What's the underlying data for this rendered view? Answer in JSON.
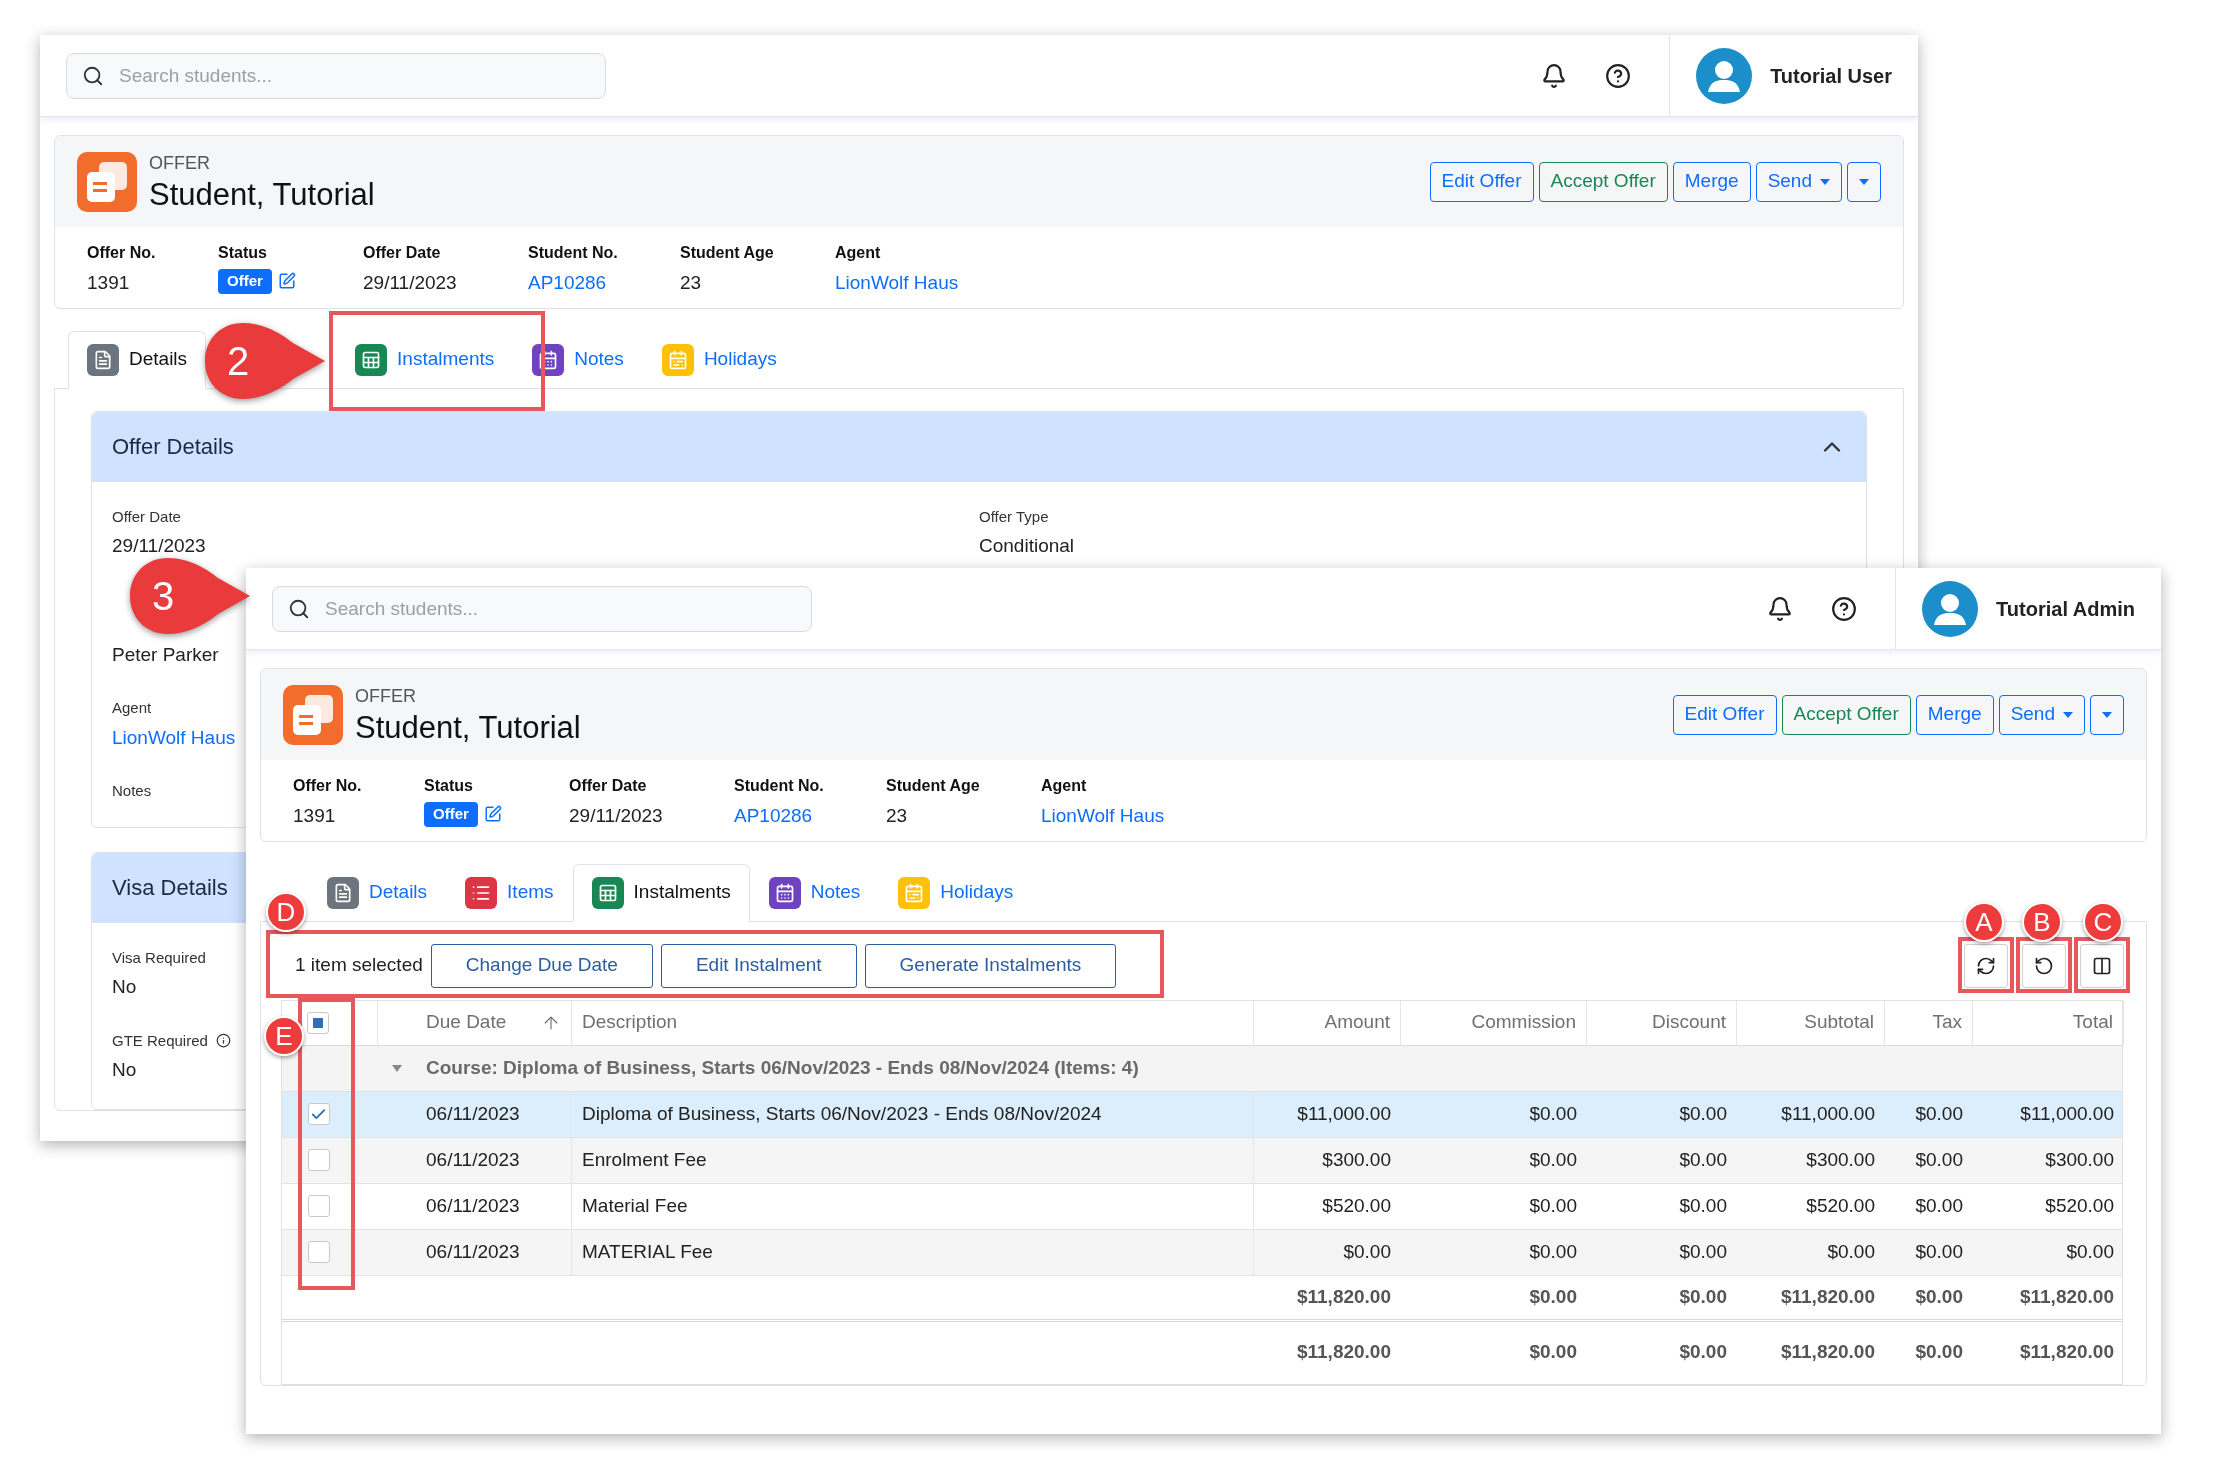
{
  "windows": [
    {
      "kind": "details",
      "search": {
        "placeholder": "Search students..."
      },
      "user": {
        "name": "Tutorial User"
      },
      "offer": {
        "type_label": "OFFER",
        "name": "Student, Tutorial",
        "buttons": [
          {
            "label": "Edit Offer",
            "kind": "primary"
          },
          {
            "label": "Accept Offer",
            "kind": "success"
          },
          {
            "label": "Merge",
            "kind": "primary"
          },
          {
            "label": "Send",
            "kind": "dropdown"
          },
          {
            "kind": "caret"
          }
        ],
        "fields": [
          {
            "label": "Offer No.",
            "value": "1391",
            "kind": "text"
          },
          {
            "label": "Status",
            "value": "Offer",
            "kind": "badge"
          },
          {
            "label": "Offer Date",
            "value": "29/11/2023",
            "kind": "text"
          },
          {
            "label": "Student No.",
            "value": "AP10286",
            "kind": "link"
          },
          {
            "label": "Student Age",
            "value": "23",
            "kind": "text"
          },
          {
            "label": "Agent",
            "value": "LionWolf Haus",
            "kind": "link"
          }
        ]
      },
      "tabs": [
        {
          "label": "Details",
          "kind": "details",
          "color": "#6c757d",
          "selected": true
        },
        {
          "label": "Instalments",
          "kind": "instalments",
          "color": "#198754",
          "selected": false
        },
        {
          "label": "Notes",
          "kind": "notes",
          "color": "#6f42c1",
          "selected": false
        },
        {
          "label": "Holidays",
          "kind": "holidays",
          "color": "#ffc107",
          "selected": false
        }
      ],
      "sections": [
        {
          "title": "Offer Details",
          "expanded": true,
          "fields": [
            {
              "label": "Offer Date",
              "value": "29/11/2023",
              "kind": "text"
            },
            {
              "value": "Peter Parker",
              "kind": "text"
            },
            {
              "label": "Agent",
              "value": "LionWolf Haus",
              "kind": "link"
            },
            {
              "label": "Notes",
              "kind": "text"
            }
          ],
          "side_fields": [
            {
              "label": "Offer Type",
              "value": "Conditional",
              "kind": "text"
            }
          ]
        },
        {
          "title": "Visa Details",
          "fields": [
            {
              "label": "Visa Required",
              "value": "No",
              "kind": "text"
            },
            {
              "label": "GTE Required",
              "value": "No",
              "kind": "info"
            }
          ]
        }
      ]
    },
    {
      "kind": "instalments",
      "search": {
        "placeholder": "Search students..."
      },
      "user": {
        "name": "Tutorial Admin"
      },
      "offer": {
        "type_label": "OFFER",
        "name": "Student, Tutorial",
        "buttons": [
          {
            "label": "Edit Offer",
            "kind": "primary"
          },
          {
            "label": "Accept Offer",
            "kind": "success"
          },
          {
            "label": "Merge",
            "kind": "primary"
          },
          {
            "label": "Send",
            "kind": "dropdown"
          },
          {
            "kind": "caret"
          }
        ],
        "fields": [
          {
            "label": "Offer No.",
            "value": "1391",
            "kind": "text"
          },
          {
            "label": "Status",
            "value": "Offer",
            "kind": "badge"
          },
          {
            "label": "Offer Date",
            "value": "29/11/2023",
            "kind": "text"
          },
          {
            "label": "Student No.",
            "value": "AP10286",
            "kind": "link"
          },
          {
            "label": "Student Age",
            "value": "23",
            "kind": "text"
          },
          {
            "label": "Agent",
            "value": "LionWolf Haus",
            "kind": "link"
          }
        ]
      },
      "tabs": [
        {
          "label": "Details",
          "kind": "details",
          "color": "#6c757d",
          "selected": false
        },
        {
          "label": "Items",
          "kind": "items",
          "color": "#dc3545",
          "selected": false
        },
        {
          "label": "Instalments",
          "kind": "instalments",
          "color": "#198754",
          "selected": true
        },
        {
          "label": "Notes",
          "kind": "notes",
          "color": "#6f42c1",
          "selected": false
        },
        {
          "label": "Holidays",
          "kind": "holidays",
          "color": "#ffc107",
          "selected": false
        }
      ],
      "instalments": {
        "selection_text": "1 item selected",
        "actions": [
          "Change Due Date",
          "Edit Instalment",
          "Generate Instalments"
        ],
        "tools": [
          {
            "kind": "refresh"
          },
          {
            "kind": "reset"
          },
          {
            "kind": "columns"
          }
        ],
        "table": {
          "select_all": {
            "indeterminate": true
          },
          "columns": [
            {
              "label": "Due Date",
              "kind": "text",
              "sorted": true
            },
            {
              "label": "Description",
              "kind": "text",
              "sorted": false
            },
            {
              "label": "Amount",
              "kind": "money",
              "sorted": false
            },
            {
              "label": "Commission",
              "kind": "money",
              "sorted": false
            },
            {
              "label": "Discount",
              "kind": "money",
              "sorted": false
            },
            {
              "label": "Subtotal",
              "kind": "money",
              "sorted": false
            },
            {
              "label": "Tax",
              "kind": "money",
              "sorted": false
            },
            {
              "label": "Total",
              "kind": "money",
              "sorted": false
            }
          ],
          "groups": [
            {
              "title": "Course: Diploma of Business, Starts 06/Nov/2023 - Ends 08/Nov/2024 (Items: 4)",
              "expanded": true,
              "rows": [
                {
                  "selected": true,
                  "cells": [
                    "06/11/2023",
                    "Diploma of Business, Starts 06/Nov/2023 - Ends 08/Nov/2024",
                    "$11,000.00",
                    "$0.00",
                    "$0.00",
                    "$11,000.00",
                    "$0.00",
                    "$11,000.00"
                  ]
                },
                {
                  "selected": false,
                  "cells": [
                    "06/11/2023",
                    "Enrolment Fee",
                    "$300.00",
                    "$0.00",
                    "$0.00",
                    "$300.00",
                    "$0.00",
                    "$300.00"
                  ]
                },
                {
                  "selected": false,
                  "cells": [
                    "06/11/2023",
                    "Material Fee",
                    "$520.00",
                    "$0.00",
                    "$0.00",
                    "$520.00",
                    "$0.00",
                    "$520.00"
                  ]
                },
                {
                  "selected": false,
                  "cells": [
                    "06/11/2023",
                    "MATERIAL Fee",
                    "$0.00",
                    "$0.00",
                    "$0.00",
                    "$0.00",
                    "$0.00",
                    "$0.00"
                  ]
                }
              ]
            }
          ],
          "totals": [
            [
              "$11,820.00",
              "$0.00",
              "$0.00",
              "$11,820.00",
              "$0.00",
              "$11,820.00"
            ],
            [
              "$11,820.00",
              "$0.00",
              "$0.00",
              "$11,820.00",
              "$0.00",
              "$11,820.00"
            ]
          ]
        }
      }
    }
  ],
  "annotations": {
    "callouts": [
      {
        "label": "2"
      },
      {
        "label": "3"
      }
    ],
    "markers": [
      {
        "label": "D"
      },
      {
        "label": "E"
      },
      {
        "label": "A"
      },
      {
        "label": "B"
      },
      {
        "label": "C"
      }
    ]
  }
}
